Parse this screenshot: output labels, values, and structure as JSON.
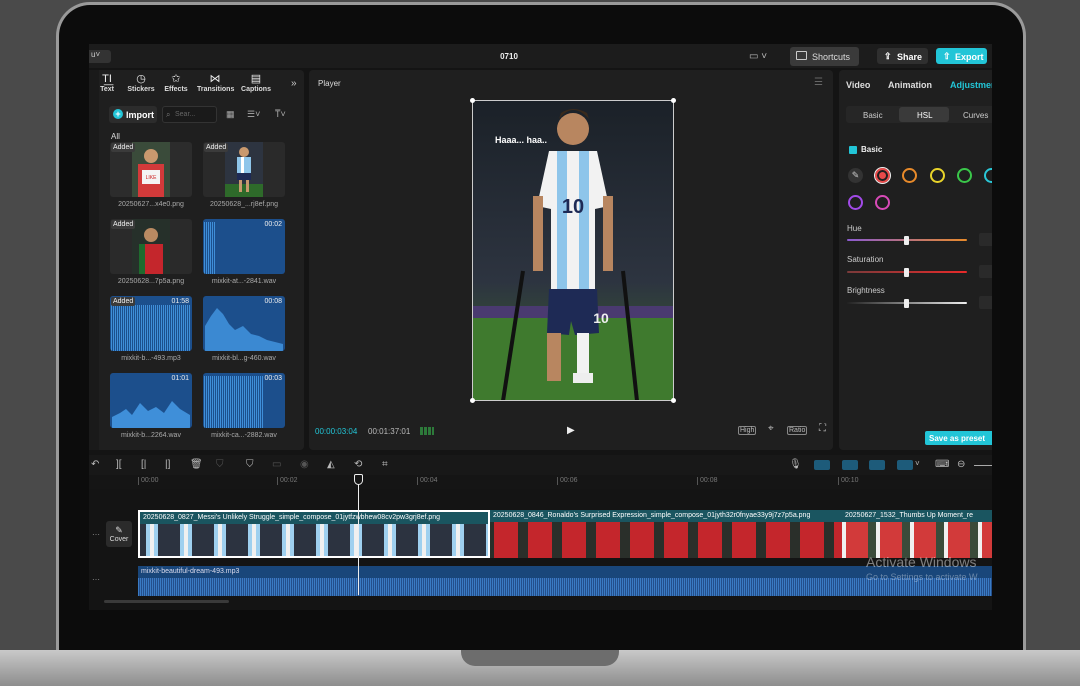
{
  "window": {
    "project_menu": "u",
    "title": "0710",
    "shortcuts_label": "Shortcuts",
    "share_label": "Share",
    "export_label": "Export"
  },
  "media_panel": {
    "tools": [
      {
        "label": "Text",
        "icon": "text-icon"
      },
      {
        "label": "Stickers",
        "icon": "sticker-icon"
      },
      {
        "label": "Effects",
        "icon": "effects-icon"
      },
      {
        "label": "Transitions",
        "icon": "transitions-icon"
      },
      {
        "label": "Captions",
        "icon": "captions-icon"
      }
    ],
    "import_label": "Import",
    "search_placeholder": "Sear...",
    "filter_all": "All",
    "added_badge": "Added",
    "items": [
      {
        "name": "20250627...x4e0.png",
        "type": "image",
        "added": true,
        "duration": ""
      },
      {
        "name": "20250628_...rj8ef.png",
        "type": "image",
        "added": true,
        "duration": ""
      },
      {
        "name": "20250628...7p5a.png",
        "type": "image",
        "added": true,
        "duration": ""
      },
      {
        "name": "mixkit-at...-2841.wav",
        "type": "audio",
        "added": false,
        "duration": "00:02"
      },
      {
        "name": "mixkit-b...-493.mp3",
        "type": "audio",
        "added": true,
        "duration": "01:58"
      },
      {
        "name": "mixkit-bl...g-460.wav",
        "type": "audio",
        "added": false,
        "duration": "00:08"
      },
      {
        "name": "mixkit-b...2264.wav",
        "type": "audio",
        "added": false,
        "duration": "01:01"
      },
      {
        "name": "mixkit-ca...-2882.wav",
        "type": "audio",
        "added": false,
        "duration": "00:03"
      }
    ]
  },
  "player": {
    "title": "Player",
    "caption_text": "Haaa... haa..",
    "current_time": "00:00:03:04",
    "total_time": "00:01:37:01",
    "quality_label": "High",
    "ratio_label": "Ratio"
  },
  "properties": {
    "tabs": [
      "Video",
      "Animation",
      "Adjustment"
    ],
    "sub_tabs": [
      "Basic",
      "HSL",
      "Curves"
    ],
    "active_sub_tab": "HSL",
    "section_label": "Basic",
    "color_swatches": [
      "#e84a4a",
      "#e88a2a",
      "#e8d32a",
      "#3ac74a",
      "#2ac7d7",
      "#a24ae8",
      "#d84ab8"
    ],
    "sliders": [
      {
        "label": "Hue",
        "value": 0
      },
      {
        "label": "Saturation",
        "value": 0
      },
      {
        "label": "Brightness",
        "value": 0
      }
    ],
    "save_preset_label": "Save as preset"
  },
  "timeline": {
    "ruler_ticks": [
      "00:00",
      "00:02",
      "00:04",
      "00:06",
      "00:08",
      "00:10"
    ],
    "cover_label": "Cover",
    "video_clips": [
      {
        "label": "20250628_0827_Messi's Unlikely Struggle_simple_compose_01jytfzwbhew08cv2pw3grj8ef.png"
      },
      {
        "label": "20250628_0846_Ronaldo's Surprised Expression_simple_compose_01jyth32r0fnyae33y9j7z7p5a.png"
      },
      {
        "label": "20250627_1532_Thumbs Up Moment_re"
      }
    ],
    "audio_clip_label": "mixkit-beautiful-dream-493.mp3"
  },
  "os_watermark": {
    "title": "Activate Windows",
    "subtitle": "Go to Settings to activate W"
  },
  "colors": {
    "accent": "#22c5d7",
    "panel_bg": "#1f1f1f",
    "audio_clip": "#19467a",
    "video_clip": "#1a5560"
  }
}
